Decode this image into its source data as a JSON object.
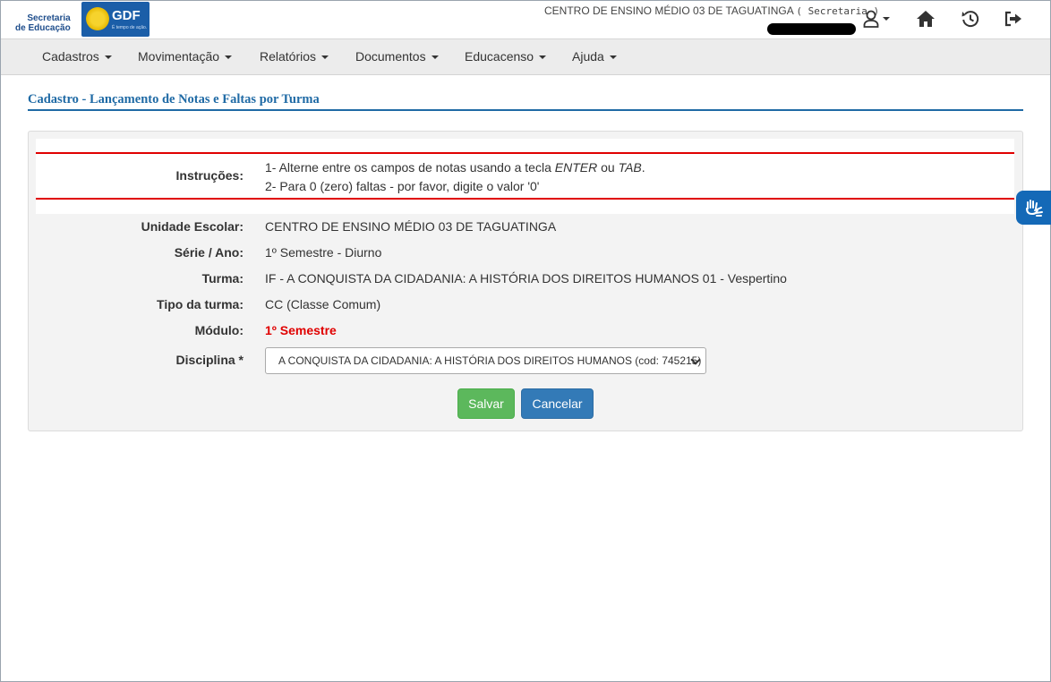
{
  "header": {
    "logo_secretaria_line1": "Secretaria",
    "logo_secretaria_line2": "de Educação",
    "logo_gdf": "GDF",
    "logo_gdf_sub": "É tempo de ação.",
    "school_name": "CENTRO DE ENSINO MÉDIO 03 DE TAGUATINGA",
    "role": "( Secretaria )",
    "icons": [
      "user-icon",
      "home-icon",
      "history-icon",
      "logout-icon"
    ]
  },
  "nav": {
    "items": [
      {
        "label": "Cadastros"
      },
      {
        "label": "Movimentação"
      },
      {
        "label": "Relatórios"
      },
      {
        "label": "Documentos"
      },
      {
        "label": "Educacenso"
      },
      {
        "label": "Ajuda"
      }
    ]
  },
  "page": {
    "title": "Cadastro - Lançamento de Notas e Faltas por Turma"
  },
  "form": {
    "instrucoes_label": "Instruções:",
    "instr1_pre": "1- Alterne entre os campos de notas usando a tecla ",
    "instr1_key1": "ENTER",
    "instr1_mid": " ou ",
    "instr1_key2": "TAB",
    "instr1_end": ".",
    "instr2": "2- Para 0 (zero) faltas - por favor, digite o valor '0'",
    "unidade_label": "Unidade Escolar:",
    "unidade_value": "CENTRO DE ENSINO MÉDIO 03 DE TAGUATINGA",
    "serie_label": "Série / Ano:",
    "serie_value": "1º Semestre - Diurno",
    "turma_label": "Turma:",
    "turma_value": "IF - A CONQUISTA DA CIDADANIA: A HISTÓRIA DOS DIREITOS HUMANOS 01 - Vespertino",
    "tipo_label": "Tipo da turma:",
    "tipo_value": "CC (Classe Comum)",
    "modulo_label": "Módulo:",
    "modulo_value": "1º Semestre",
    "disciplina_label": "Disciplina *",
    "disciplina_selected": "A CONQUISTA DA CIDADANIA: A HISTÓRIA DOS DIREITOS HUMANOS (cod: 745215)",
    "save_label": "Salvar",
    "cancel_label": "Cancelar"
  },
  "colors": {
    "title_blue": "#1f6aa5",
    "instruction_rule": "#e00000",
    "save_green": "#5cb85c",
    "cancel_blue": "#337ab7",
    "accessibility_blue": "#1469b7"
  }
}
